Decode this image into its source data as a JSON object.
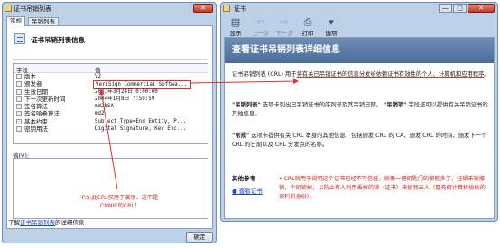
{
  "left_dialog": {
    "title": "证书吊销列表",
    "close_glyph": "✕",
    "tabs": [
      {
        "label": "常规"
      },
      {
        "label": "吊销列表"
      }
    ],
    "info_title": "证书吊销列表信息",
    "columns": [
      "字段",
      "值"
    ],
    "rows": [
      {
        "field": "版本",
        "value": "V2"
      },
      {
        "field": "颁发者",
        "value": "VeriSign Commercial Softwa..."
      },
      {
        "field": "生效日期",
        "value": "2001年3月24日 0:00:00"
      },
      {
        "field": "下一次更新时间",
        "value": "2004年1月8日 7:59:59"
      },
      {
        "field": "签名算法",
        "value": "md2RSA"
      },
      {
        "field": "签名哈希算法",
        "value": "md2"
      },
      {
        "field": "基本约束",
        "value": "Subject Type=End Entity, P..."
      },
      {
        "field": "密钥用法",
        "value": "Digital Signature, Key Enc..."
      }
    ],
    "value_label": "值(V):",
    "note": "P.S.此CRL仅用于演示，这不是CNNIC的CRL！",
    "bottom_prefix": "了解",
    "bottom_link": "证书吊销列表",
    "bottom_suffix": "的详细信息",
    "ok_label": "确定"
  },
  "help_window": {
    "title": "证书",
    "controls": {
      "min": "—",
      "max": "□",
      "close": "✕"
    },
    "toolbar": [
      {
        "label": "显示",
        "glyph": "▤"
      },
      {
        "label": "上一步",
        "glyph": "⇦"
      },
      {
        "label": "下一步",
        "glyph": "⇨"
      },
      {
        "label": "打印",
        "glyph": "⎙"
      },
      {
        "label": "选项",
        "glyph": "▾"
      }
    ],
    "heading": "查看证书吊销列表详细信息",
    "p1_a": "证书吊销列表 (CRL) 用于",
    "p1_b": "将有关已吊销证书的信息分发给依赖证书有效性的个人、计算机和应用程序",
    "p1_c": "。",
    "p2_bold": "\"吊销列表\"",
    "p2_a": "选项卡列出已吊销证书的序列号及其吊销日期。",
    "p2_bold2": "\"吊销项\"",
    "p2_b": "字段还可以提供有关吊销证书的其他信息。",
    "p3_bold": "\"常规\"",
    "p3_a": "选项卡提供有关 CRL 本身的其他信息，包括颁发 CRL 的 CA、颁发 CRL 的时间、颁发下一个 CRL 的日期以及 CRL 分发点的名称。",
    "other_title": "其他参考",
    "other_link": "查看证书",
    "other_note": "• CRL就用于说明这个证书已经不可信任，就像一把钥匙门的锁能多了，挂锁未被撤销，个钥锁掉，以防止有人利用丢掉的锁（证书）来偷我去人（冒充假计算机偷偷的资料的身份）。"
  }
}
